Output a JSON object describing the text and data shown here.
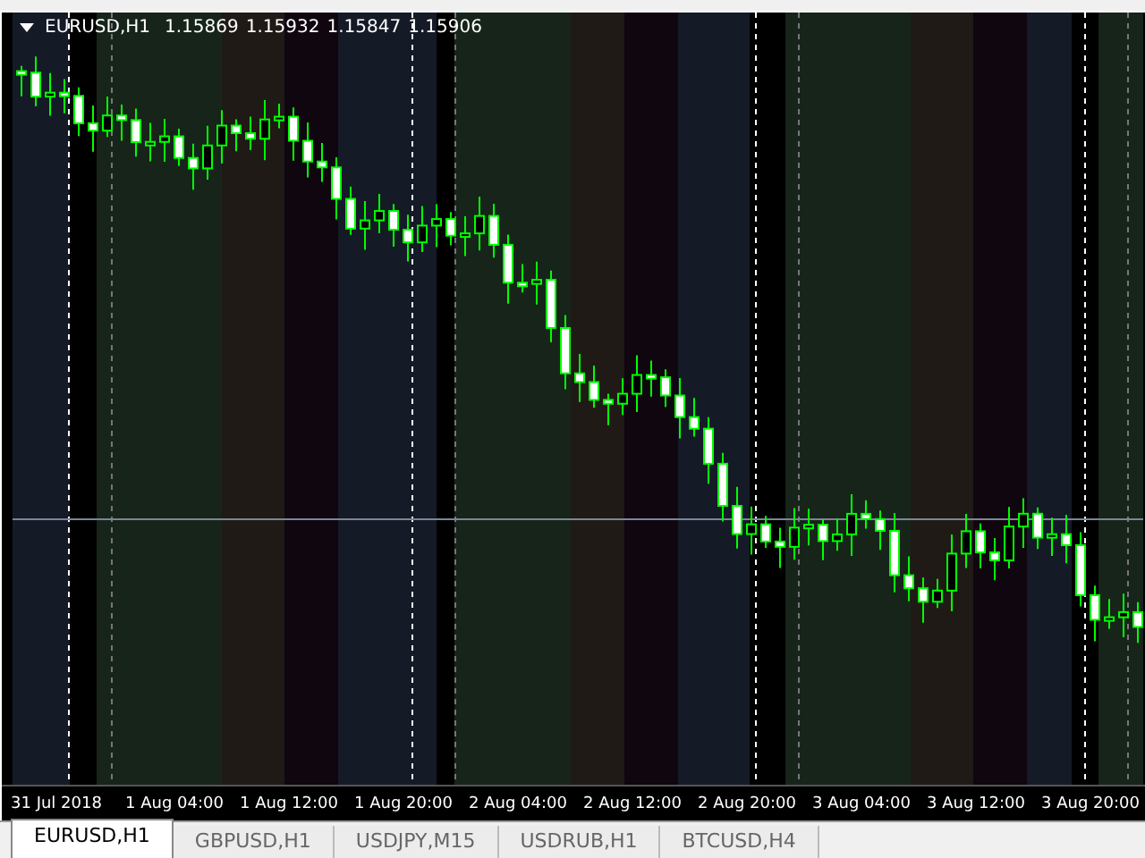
{
  "chart": {
    "symbol": "EURUSD,H1",
    "quotes": [
      "1.15869",
      "1.15932",
      "1.15847",
      "1.15906"
    ]
  },
  "time_axis": {
    "labels": [
      "31 Jul 2018",
      "1 Aug 04:00",
      "1 Aug 12:00",
      "1 Aug 20:00",
      "2 Aug 04:00",
      "2 Aug 12:00",
      "2 Aug 20:00",
      "3 Aug 04:00",
      "3 Aug 12:00",
      "3 Aug 20:00"
    ]
  },
  "tabs": [
    {
      "label": "EURUSD,H1",
      "selected": true
    },
    {
      "label": "GBPUSD,H1",
      "selected": false
    },
    {
      "label": "USDJPY,M15",
      "selected": false
    },
    {
      "label": "USDRUB,H1",
      "selected": false
    },
    {
      "label": "BTCUSD,H4",
      "selected": false
    }
  ]
}
